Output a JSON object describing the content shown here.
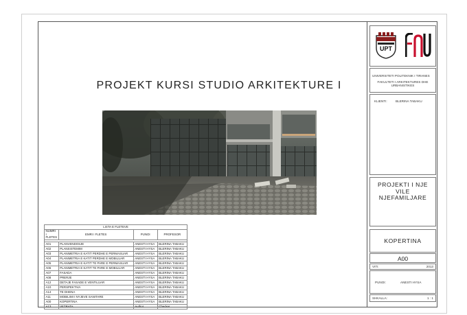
{
  "sheet_title": "PROJEKT KURSI STUDIO ARKITEKTURE I",
  "logos": {
    "left": "UPT",
    "right": "FAU",
    "right_icon": "fau-logo-icon"
  },
  "title_block": {
    "university": "UNIVERSITETI POLITEKNIK I TIRANES",
    "faculty_line1": "FAKULTETI I ARKITEKTURES DHE",
    "faculty_line2": "URBANISTIKES",
    "client_label": "KLIENTI:",
    "client_value": "BLERINA TABAKU",
    "project_line1": "PROJEKTI I NJE",
    "project_line2": "VILE",
    "project_line3": "NJEFAMILJARE",
    "drawing_name": "KOPERTINA",
    "sheet_number": "A00",
    "year_label": "VITI:",
    "year_value": "2013",
    "work_label": "PUNOI:",
    "work_value": "ANESTI HYSA",
    "scale_label": "SHKALLA:",
    "scale_value": "1 : 1"
  },
  "sheet_list": {
    "title": "LISTA E FLETEVE",
    "headers": {
      "number": "NUMRI I FLETES",
      "name": "EMRI I FLETES",
      "worker": "PUNOI",
      "professor": "PROFESOR"
    },
    "rows": [
      [
        "A01",
        "PLANVENDOSJE",
        "ANESTI HYSA",
        "BLERINA TABAKU"
      ],
      [
        "A02",
        "PLANSISTEMIM",
        "ANESTI HYSA",
        "BLERINA TABAKU"
      ],
      [
        "A03",
        "PLANIMETRIA E KATIT PERDHE E PERMASUAR",
        "ANESTI HYSA",
        "BLERINA TABAKU"
      ],
      [
        "A04",
        "PLANIMETRIA E KATIT PERDHE E MOBILUAR",
        "ANESTI HYSA",
        "BLERINA TABAKU"
      ],
      [
        "A05",
        "PLANIMETRIA E KATIT TE PARE E PERMASUAR",
        "ANESTI HYSA",
        "BLERINA TABAKU"
      ],
      [
        "A06",
        "PLANIMETRIA E KATIT TE PARE E MOBILUAR",
        "ANESTI HYSA",
        "BLERINA TABAKU"
      ],
      [
        "A07",
        "FASADA",
        "ANESTI HYSA",
        "BLERINA TABAKU"
      ],
      [
        "A08",
        "PRERJE",
        "ANESTI HYSA",
        "BLERINA TABAKU"
      ],
      [
        "A12",
        "DETAJE FASADE E VENTILUAR",
        "ANESTI HYSA",
        "BLERINA TABAKU"
      ],
      [
        "A10",
        "PERSPEKTIVA",
        "ANESTI HYSA",
        "BLERINA TABAKU"
      ],
      [
        "A14",
        "TE DHENA",
        "ANESTI HYSA",
        "BLERINA TABAKU"
      ],
      [
        "A11",
        "MOBILIMI I NYJEVE SANITARE",
        "ANESTI HYSA",
        "BLERINA TABAKU"
      ],
      [
        "A00",
        "KOPERTINA",
        "ANESTI HYSA",
        "BLERINA TABAKU"
      ],
      [
        "A13",
        "VETRATA",
        "Author",
        "Checker"
      ]
    ]
  }
}
